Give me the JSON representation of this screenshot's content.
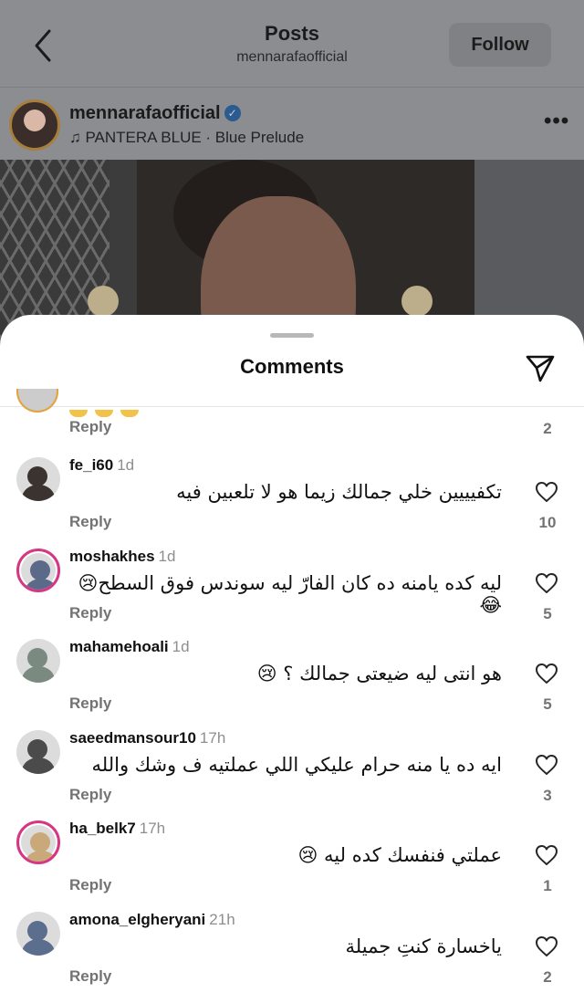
{
  "header": {
    "title": "Posts",
    "subtitle": "mennarafaofficial",
    "follow_label": "Follow"
  },
  "post": {
    "username": "mennarafaofficial",
    "verified_mark": "✓",
    "music": "♫ PANTERA BLUE · Blue Prelude",
    "more_label": "•••"
  },
  "comments_sheet": {
    "title": "Comments",
    "partial_comment": {
      "reply_label": "Reply",
      "likes": "2"
    },
    "items": [
      {
        "username": "fe_i60",
        "time": "1d",
        "text": "تكفيييين خلي جمالك زيما هو لا تلعبين فيه",
        "reply_label": "Reply",
        "likes": "10",
        "avatar_color": "#3a3330",
        "story_ring": false
      },
      {
        "username": "moshakhes",
        "time": "1d",
        "text": "ليه كده يامنه ده كان الفارّ ليه سوندس فوق السطح😢😂",
        "reply_label": "Reply",
        "likes": "5",
        "avatar_color": "#5a6a88",
        "story_ring": true
      },
      {
        "username": "mahamehoali",
        "time": "1d",
        "text": "هو انتى ليه ضيعتى جمالك ؟ 😢",
        "reply_label": "Reply",
        "likes": "5",
        "avatar_color": "#7a8a80",
        "story_ring": false
      },
      {
        "username": "saeedmansour10",
        "time": "17h",
        "text": "ايه ده يا منه حرام عليكي اللي عملتيه ف وشك والله",
        "reply_label": "Reply",
        "likes": "3",
        "avatar_color": "#4b4b4b",
        "story_ring": false
      },
      {
        "username": "ha_belk7",
        "time": "17h",
        "text": "عملتي فنفسك كده ليه 😢",
        "reply_label": "Reply",
        "likes": "1",
        "avatar_color": "#c9a87a",
        "story_ring": true
      },
      {
        "username": "amona_elgheryani",
        "time": "21h",
        "text": "ياخسارة كنتِ جميلة",
        "reply_label": "Reply",
        "likes": "2",
        "avatar_color": "#5c6e8e",
        "story_ring": false
      }
    ]
  }
}
